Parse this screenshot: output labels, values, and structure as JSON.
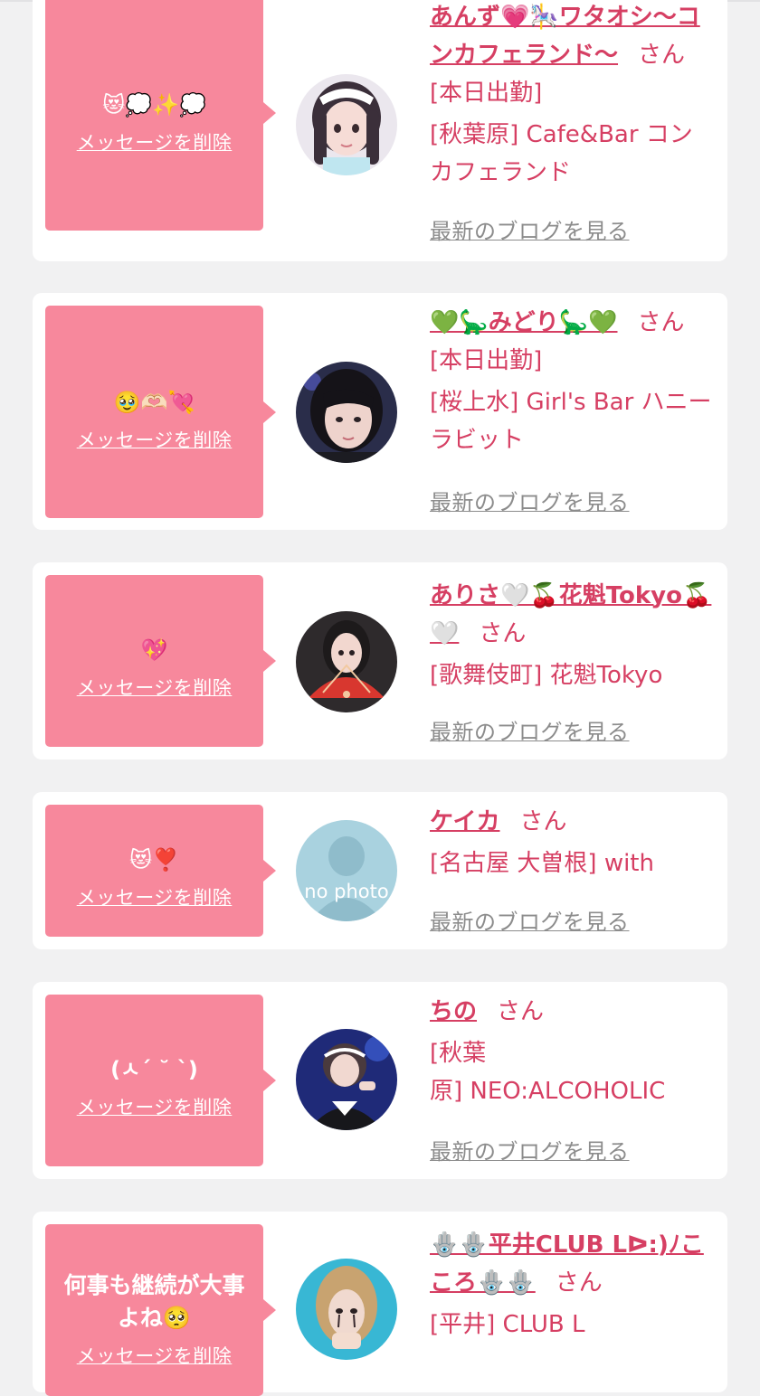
{
  "common": {
    "delete_label": "メッセージを削除",
    "blog_label": "最新のブログを見る",
    "honorific": "さん"
  },
  "cards": [
    {
      "message": "😻💭✨💭",
      "name": "あんず💗🎠ワタオシ〜コンカフェランド〜",
      "status": "[本日出勤]",
      "shop": "[秋葉原] Cafe&Bar コンカフェランド",
      "avatar": "profile-photo"
    },
    {
      "message": "🥹🫶🏻💘",
      "name": "💚🦕みどり🦕💚",
      "status": "[本日出勤]",
      "shop": "[桜上水] Girl's Bar ハニーラビット",
      "avatar": "profile-photo"
    },
    {
      "message": "💖",
      "name": "ありさ🤍🍒花魁Tokyo🍒🤍",
      "status": "",
      "shop": "[歌舞伎町] 花魁Tokyo",
      "avatar": "profile-photo"
    },
    {
      "message": "😻❣️",
      "name": "ケイカ",
      "status": "",
      "shop": "[名古屋 大曽根] with",
      "avatar": "no photo"
    },
    {
      "message": "(ㅅ´ ˘ `)",
      "name": "ちの",
      "status": "",
      "shop": "[秋葉\n原] NEO:ALCOHOLIC",
      "avatar": "profile-photo"
    },
    {
      "message": "何事も継続が大事よね🥺",
      "name": "🪬🪬平井CLUB Lᐅ:)ﾉこころ🪬🪬",
      "status": "",
      "shop": "[平井] CLUB L",
      "avatar": "profile-photo"
    }
  ],
  "colors": {
    "background": "#f1f1f2",
    "card": "#ffffff",
    "bubble": "#f7889c",
    "accent": "#d63f63",
    "link_gray": "#8c8c8c"
  }
}
